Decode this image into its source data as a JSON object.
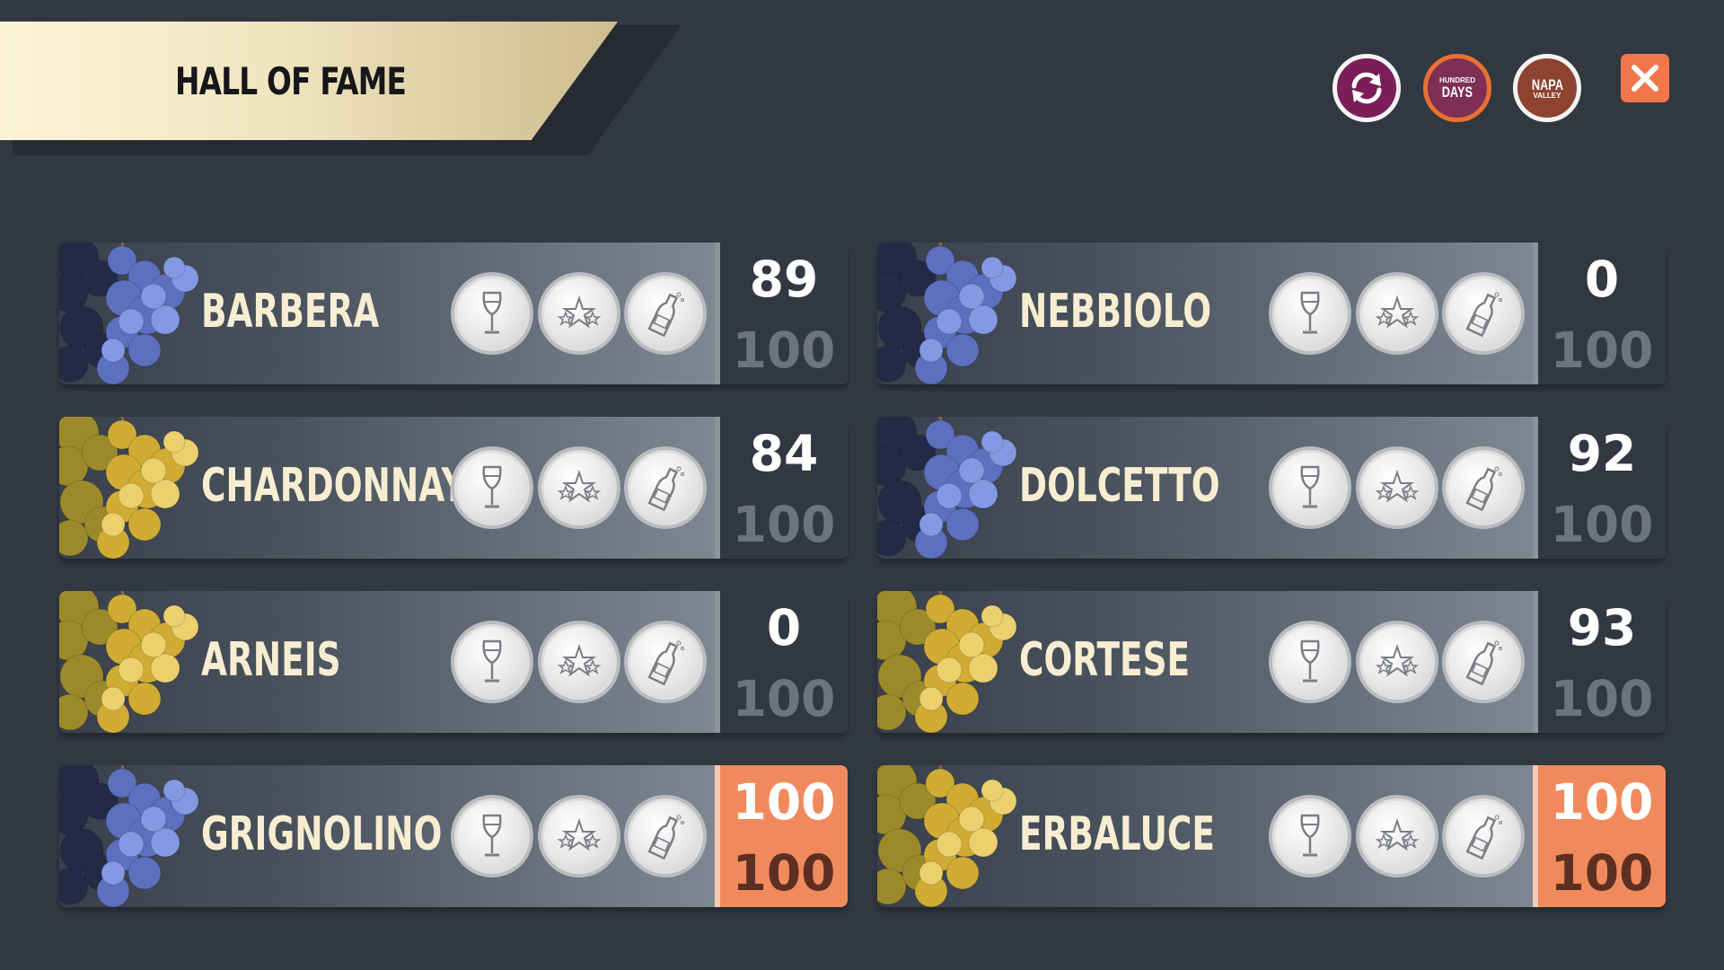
{
  "title": "HALL OF FAME",
  "header_buttons": {
    "hundred_days": {
      "line1": "HUNDRED",
      "line2": "DAYS"
    },
    "napa_valley": {
      "line1": "NAPA",
      "line2": "VALLEY"
    }
  },
  "colors": {
    "background": "#323842",
    "accent_orange": "#f08a5d",
    "close_button": "#f1774a",
    "name_text": "#f7edd1",
    "red_grape": "#6f86d6",
    "white_grape": "#e4c24a"
  },
  "wines": [
    {
      "name": "BARBERA",
      "score": "89",
      "max": "100",
      "grape": "red",
      "completed": false
    },
    {
      "name": "NEBBIOLO",
      "score": "0",
      "max": "100",
      "grape": "red",
      "completed": false
    },
    {
      "name": "CHARDONNAY",
      "score": "84",
      "max": "100",
      "grape": "white",
      "completed": false
    },
    {
      "name": "DOLCETTO",
      "score": "92",
      "max": "100",
      "grape": "red",
      "completed": false
    },
    {
      "name": "ARNEIS",
      "score": "0",
      "max": "100",
      "grape": "white",
      "completed": false
    },
    {
      "name": "CORTESE",
      "score": "93",
      "max": "100",
      "grape": "white",
      "completed": false
    },
    {
      "name": "GRIGNOLINO",
      "score": "100",
      "max": "100",
      "grape": "red",
      "completed": true
    },
    {
      "name": "ERBALUCE",
      "score": "100",
      "max": "100",
      "grape": "white",
      "completed": true
    }
  ],
  "medal_icons": [
    "wine-glass-icon",
    "stars-icon",
    "champagne-bottle-icon"
  ]
}
